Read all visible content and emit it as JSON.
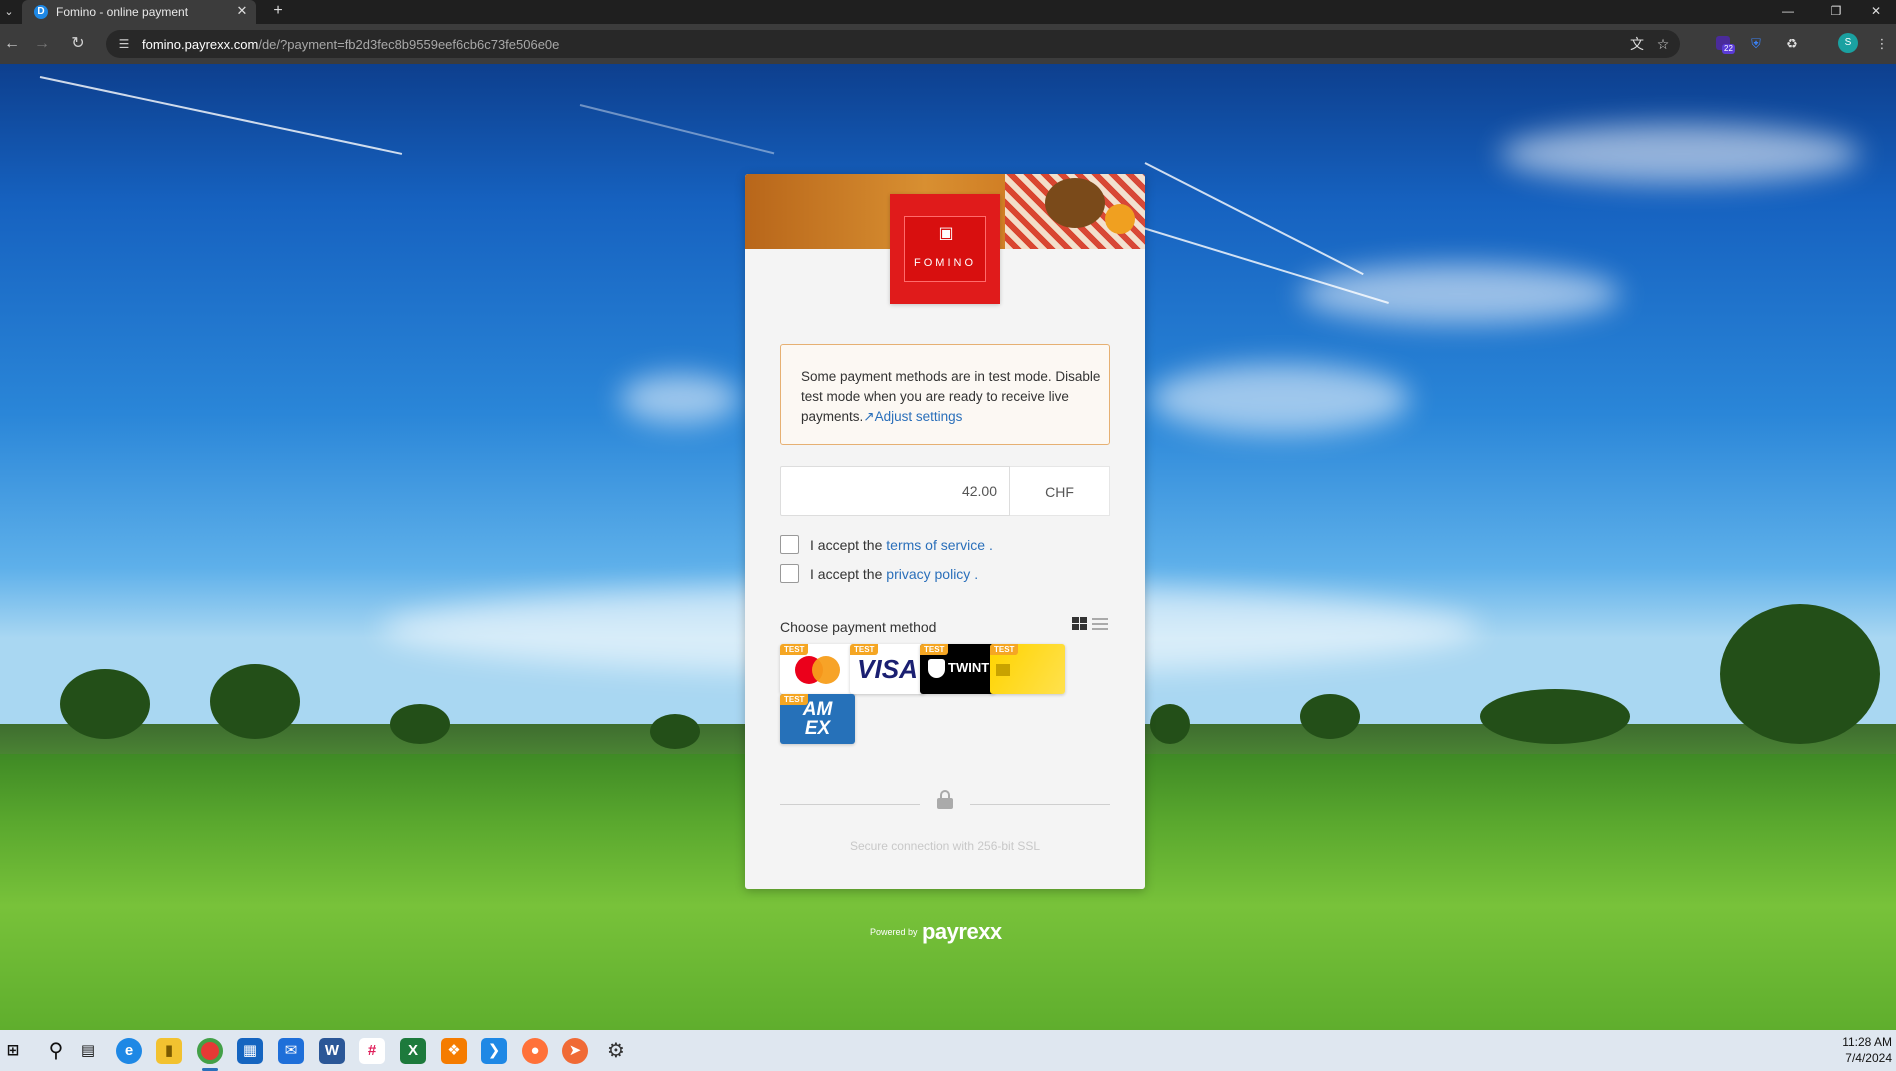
{
  "browser": {
    "tab_title": "Fomino - online payment",
    "tab_favicon": "D",
    "url_host": "fomino.payrexx.com",
    "url_path": "/de/?payment=fb2d3fec8b9559eef6cb6c73fe506e0e",
    "extension_badge": "22",
    "profile_initial": "S"
  },
  "payment": {
    "merchant_logo_text": "FOMINO",
    "notice": {
      "text": "Some payment methods are in test mode. Disable test mode when you are ready to receive live payments.",
      "link_label": "Adjust settings"
    },
    "amount": "42.00",
    "currency": "CHF",
    "terms": {
      "prefix": "I accept the",
      "link": "terms of service",
      "suffix": "."
    },
    "privacy": {
      "prefix": "I accept the",
      "link": "privacy policy",
      "suffix": "."
    },
    "methods_title": "Choose payment method",
    "test_badge": "TEST",
    "methods": [
      {
        "name": "mastercard-icon"
      },
      {
        "name": "visa-icon",
        "label": "VISA"
      },
      {
        "name": "twint-icon",
        "label": "TWINT"
      },
      {
        "name": "postfinance-card-icon"
      },
      {
        "name": "amex-icon",
        "label_top": "AM",
        "label_bottom": "EX"
      }
    ],
    "ssl_text": "Secure connection with 256-bit SSL",
    "powered_by": "Powered by",
    "powered_brand": "payrexx"
  },
  "taskbar": {
    "time": "11:28 AM",
    "date": "7/4/2024"
  }
}
